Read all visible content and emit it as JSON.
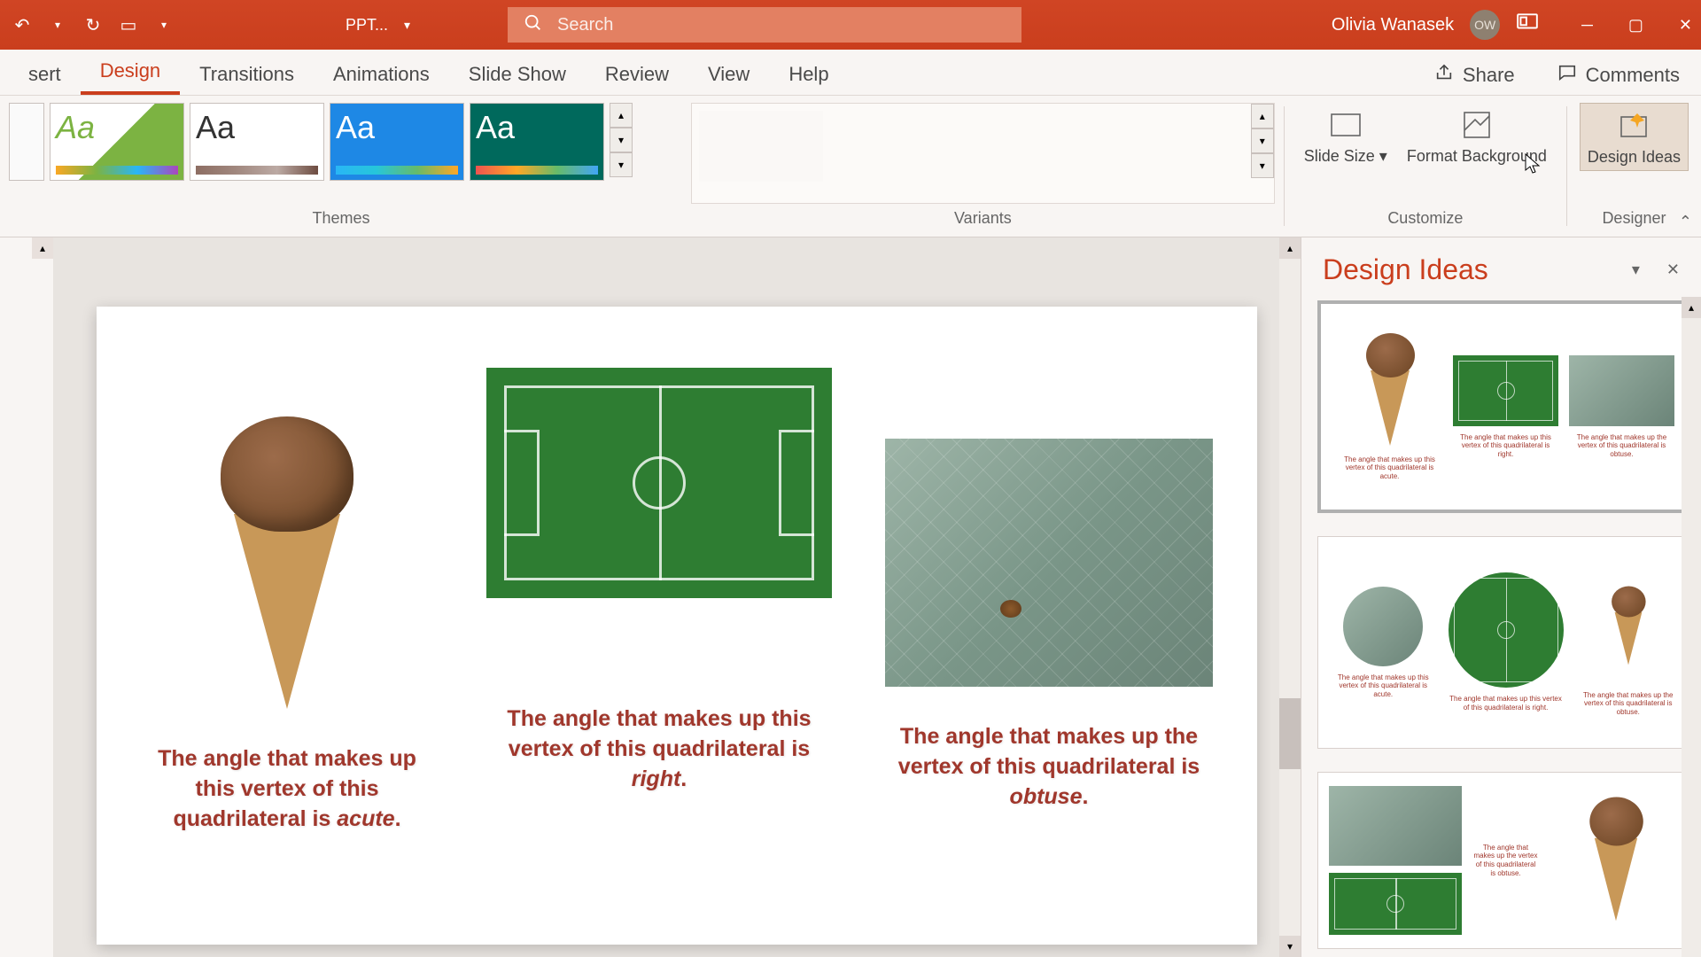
{
  "title_bar": {
    "file_label": "PPT...",
    "search_placeholder": "Search",
    "user_name": "Olivia Wanasek",
    "user_initials": "OW"
  },
  "tabs": {
    "items": [
      "sert",
      "Design",
      "Transitions",
      "Animations",
      "Slide Show",
      "Review",
      "View",
      "Help"
    ],
    "active_index": 1,
    "share": "Share",
    "comments": "Comments"
  },
  "ribbon": {
    "themes_label": "Themes",
    "variants_label": "Variants",
    "customize_label": "Customize",
    "designer_label": "Designer",
    "slide_size": "Slide Size",
    "format_bg": "Format Background",
    "design_ideas": "Design Ideas",
    "theme_aa": "Aa"
  },
  "slide": {
    "cap1_a": "The angle that makes up this vertex of this quadrilateral  is ",
    "cap1_b": "acute",
    "cap1_c": ".",
    "cap2_a": "The angle that makes up this vertex of this quadrilateral  is ",
    "cap2_b": "right",
    "cap2_c": ".",
    "cap3_a": "The angle that makes up the vertex of this quadrilateral  is ",
    "cap3_b": "obtuse",
    "cap3_c": "."
  },
  "panel": {
    "title": "Design Ideas",
    "mini_cap1": "The angle that makes up this vertex of this quadrilateral  is acute.",
    "mini_cap2": "The angle that makes up this vertex of this quadrilateral  is right.",
    "mini_cap3": "The angle that makes up the vertex of this quadrilateral  is obtuse."
  }
}
